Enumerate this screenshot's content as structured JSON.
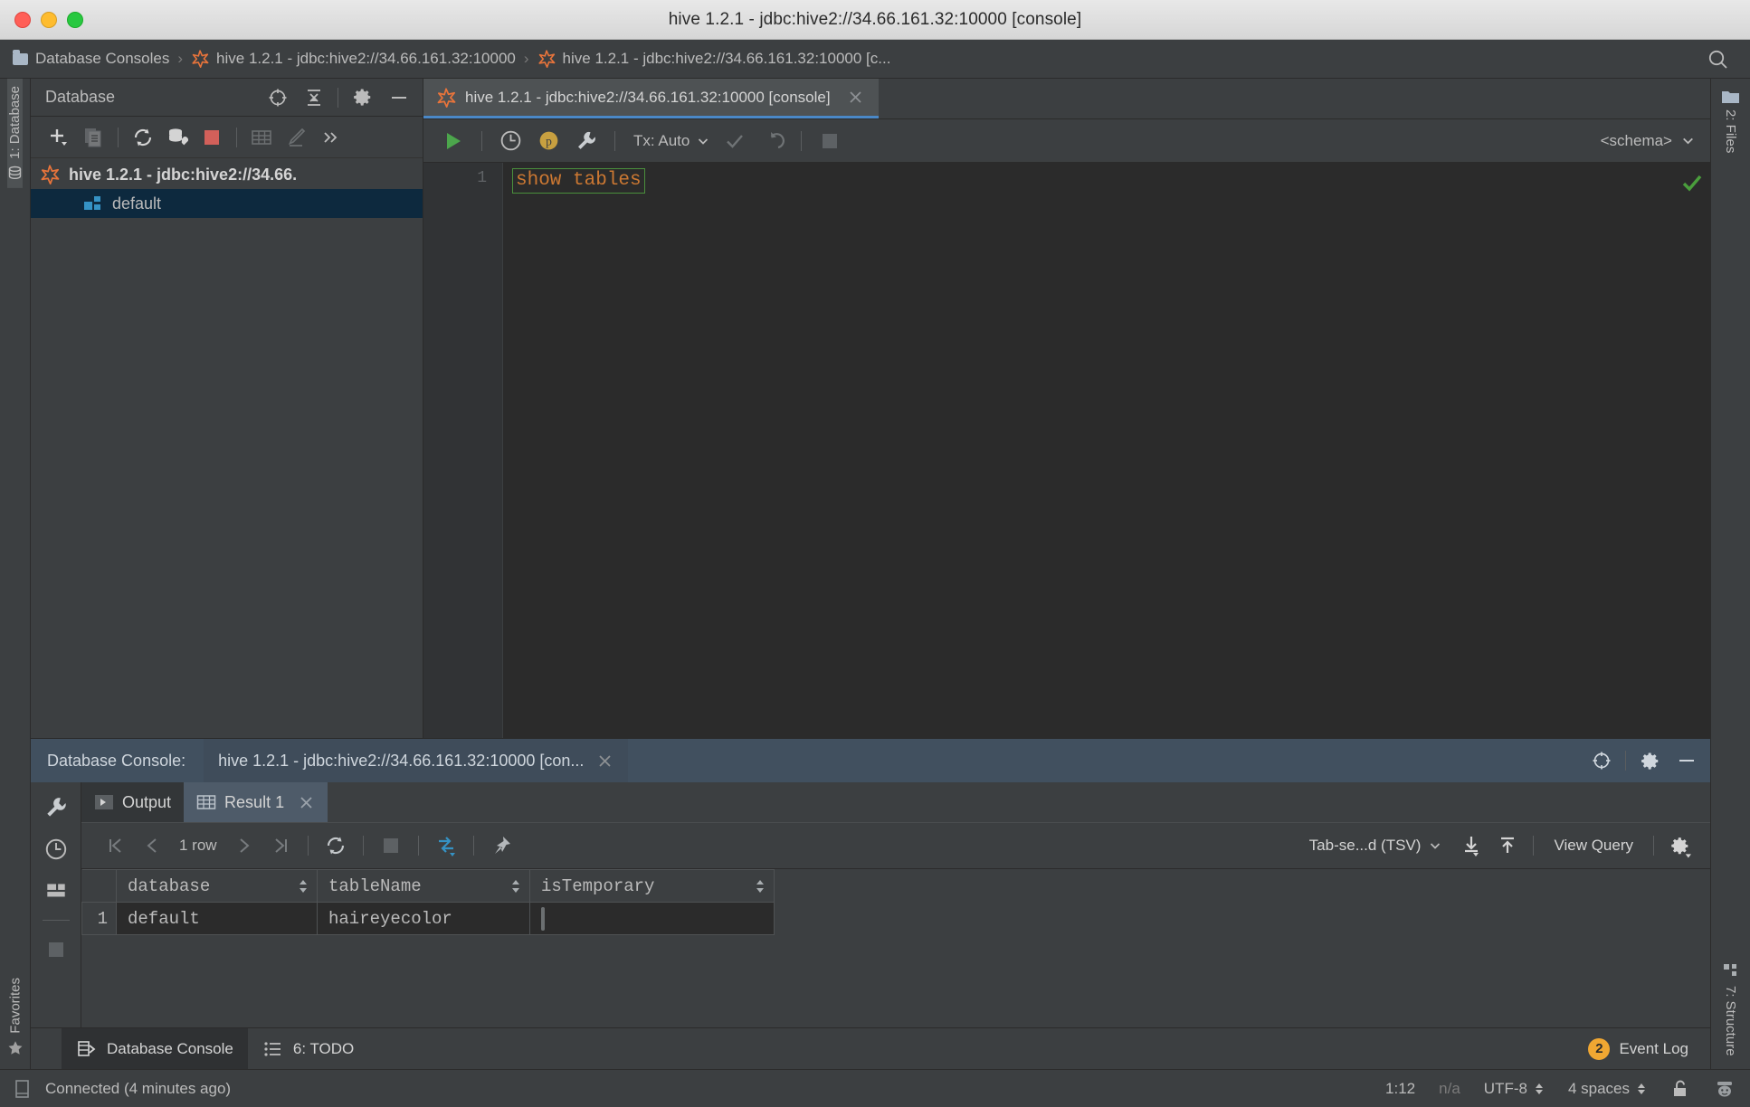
{
  "window": {
    "title": "hive 1.2.1 - jdbc:hive2://34.66.161.32:10000 [console]"
  },
  "breadcrumb": {
    "items": [
      {
        "label": "Database Consoles",
        "icon": "folder-icon"
      },
      {
        "label": "hive 1.2.1 - jdbc:hive2://34.66.161.32:10000",
        "icon": "datagrip-star-icon"
      },
      {
        "label": "hive 1.2.1 - jdbc:hive2://34.66.161.32:10000 [c...",
        "icon": "datagrip-star-icon"
      }
    ],
    "separator": "›",
    "search_icon": "search-icon"
  },
  "left_stripe": {
    "database_tab": "1: Database",
    "favorites_tab": "Favorites"
  },
  "right_stripe": {
    "files_tab": "2: Files",
    "structure_tab": "7: Structure"
  },
  "database_panel": {
    "title": "Database",
    "header_icons": [
      "locate-icon",
      "collapse-all-icon",
      "gear-icon",
      "hide-icon"
    ],
    "toolbar_icons": [
      "add-icon",
      "copy-icon",
      "refresh-icon",
      "db-tools-icon",
      "stop-icon",
      "table-editor-icon",
      "edit-icon",
      "more-icon"
    ],
    "tree": [
      {
        "label": "hive 1.2.1 - jdbc:hive2://34.66.",
        "icon": "datagrip-star-icon",
        "selected": false
      },
      {
        "label": "default",
        "icon": "schema-icon",
        "selected": true
      }
    ]
  },
  "editor": {
    "tab": {
      "label": "hive 1.2.1 - jdbc:hive2://34.66.161.32:10000 [console]",
      "icon": "datagrip-star-icon",
      "close_icon": "close-icon"
    },
    "toolbar": {
      "run_icon": "run-icon",
      "history_icon": "history-icon",
      "params_icon": "parameters-icon",
      "wrench_icon": "settings-wrench-icon",
      "tx_label": "Tx: Auto",
      "commit_icon": "commit-icon",
      "rollback_icon": "rollback-icon",
      "stop_icon": "stop-icon",
      "schema_label": "<schema>"
    },
    "line_number": "1",
    "statement": "show tables",
    "ok_marker": "check-icon"
  },
  "console_panel": {
    "header_label": "Database Console:",
    "header_tab": "hive 1.2.1 - jdbc:hive2://34.66.161.32:10000 [con...",
    "header_icons": [
      "locate-icon",
      "gear-icon",
      "hide-icon"
    ],
    "side_icons": [
      "wrench-icon",
      "history-icon",
      "layout-icon",
      "stop-icon"
    ],
    "tabs": [
      {
        "label": "Output",
        "icon": "output-icon",
        "selected": false
      },
      {
        "label": "Result 1",
        "icon": "table-icon",
        "selected": true
      }
    ],
    "grid_toolbar": {
      "first_icon": "first-page-icon",
      "prev_icon": "prev-page-icon",
      "row_count": "1 row",
      "next_icon": "next-page-icon",
      "last_icon": "last-page-icon",
      "refresh_icon": "refresh-icon",
      "stop_icon": "stop-icon",
      "transpose_icon": "value-navigation-icon",
      "pin_icon": "pin-icon",
      "format_label": "Tab-se...d (TSV)",
      "export_icon": "export-icon",
      "import_icon": "import-icon",
      "view_query_label": "View Query",
      "settings_icon": "gear-icon"
    },
    "result_grid": {
      "columns": [
        "database",
        "tableName",
        "isTemporary"
      ],
      "rows": [
        {
          "num": "1",
          "database": "default",
          "tableName": "haireyecolor",
          "isTemporary": ""
        }
      ]
    }
  },
  "tool_buttons": [
    {
      "label": "Database Console",
      "icon": "db-console-icon",
      "active": true
    },
    {
      "label": "6: TODO",
      "icon": "todo-icon",
      "active": false
    }
  ],
  "event_log": {
    "count": "2",
    "label": "Event Log"
  },
  "status_bar": {
    "connection": "Connected (4 minutes ago)",
    "connection_icon": "memory-icon",
    "position": "1:12",
    "line_sep": "n/a",
    "encoding": "UTF-8",
    "indent": "4 spaces",
    "lock_icon": "unlocked-icon",
    "inspector_icon": "inspector-icon"
  },
  "colors": {
    "accent_orange": "#cc7832",
    "accent_blue": "#4a88c7",
    "ok_green": "#4a9e3c",
    "panel_bg": "#3c3f41",
    "editor_bg": "#2b2b2b",
    "selection_blue": "#0d293e",
    "badge_orange": "#f0a732"
  }
}
